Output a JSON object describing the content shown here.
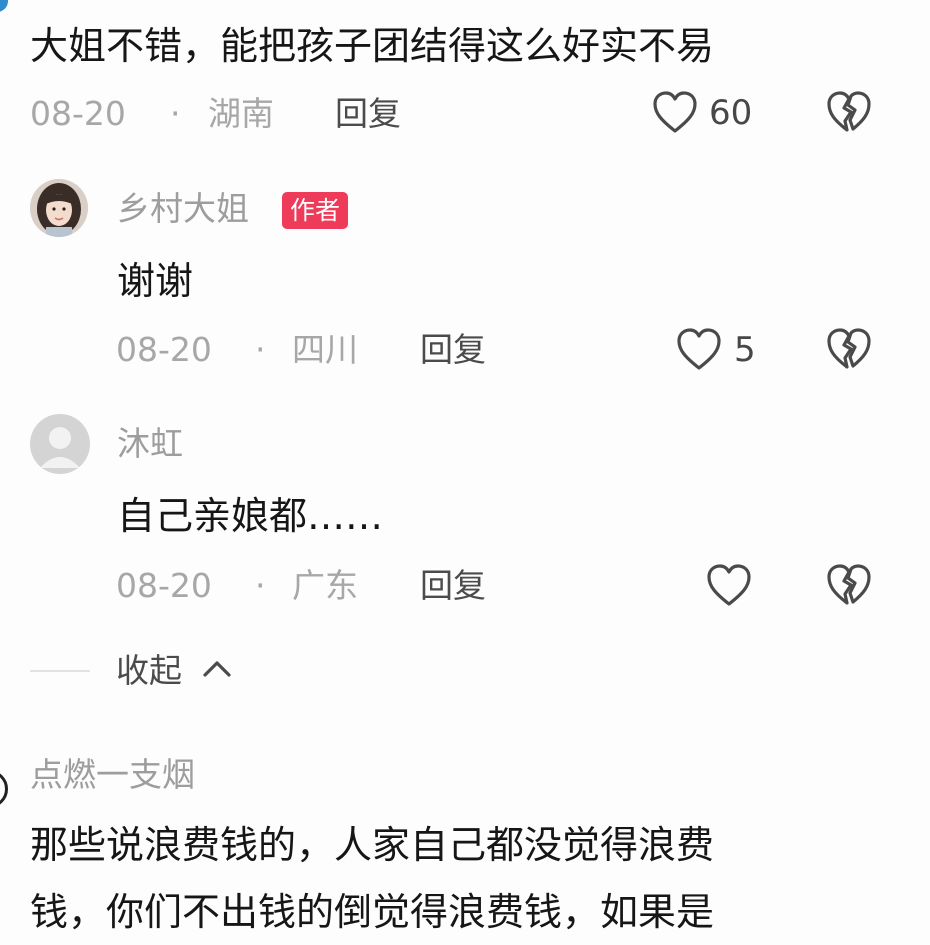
{
  "comments": [
    {
      "text": "大姐不错，能把孩子团结得这么好实不易",
      "date": "08-20",
      "sep": "·",
      "location": "湖南",
      "reply": "回复",
      "likes": "60"
    },
    {
      "author": "乡村大姐",
      "badge": "作者",
      "text": "谢谢",
      "date": "08-20",
      "sep": "·",
      "location": "四川",
      "reply": "回复",
      "likes": "5"
    },
    {
      "author": "沐虹",
      "text": "自己亲娘都……",
      "date": "08-20",
      "sep": "·",
      "location": "广东",
      "reply": "回复",
      "likes": ""
    }
  ],
  "collapse": {
    "label": "收起"
  },
  "next_comment": {
    "author": "点燃一支烟",
    "line1": "那些说浪费钱的，人家自己都没觉得浪费",
    "line2": "钱，你们不出钱的倒觉得浪费钱，如果是"
  },
  "colors": {
    "badge": "#ee3b5a",
    "meta": "#a7a7a7",
    "text": "#161616"
  },
  "icons": [
    "heart-outline-icon",
    "broken-heart-icon",
    "chevron-up-icon",
    "default-avatar-icon"
  ]
}
